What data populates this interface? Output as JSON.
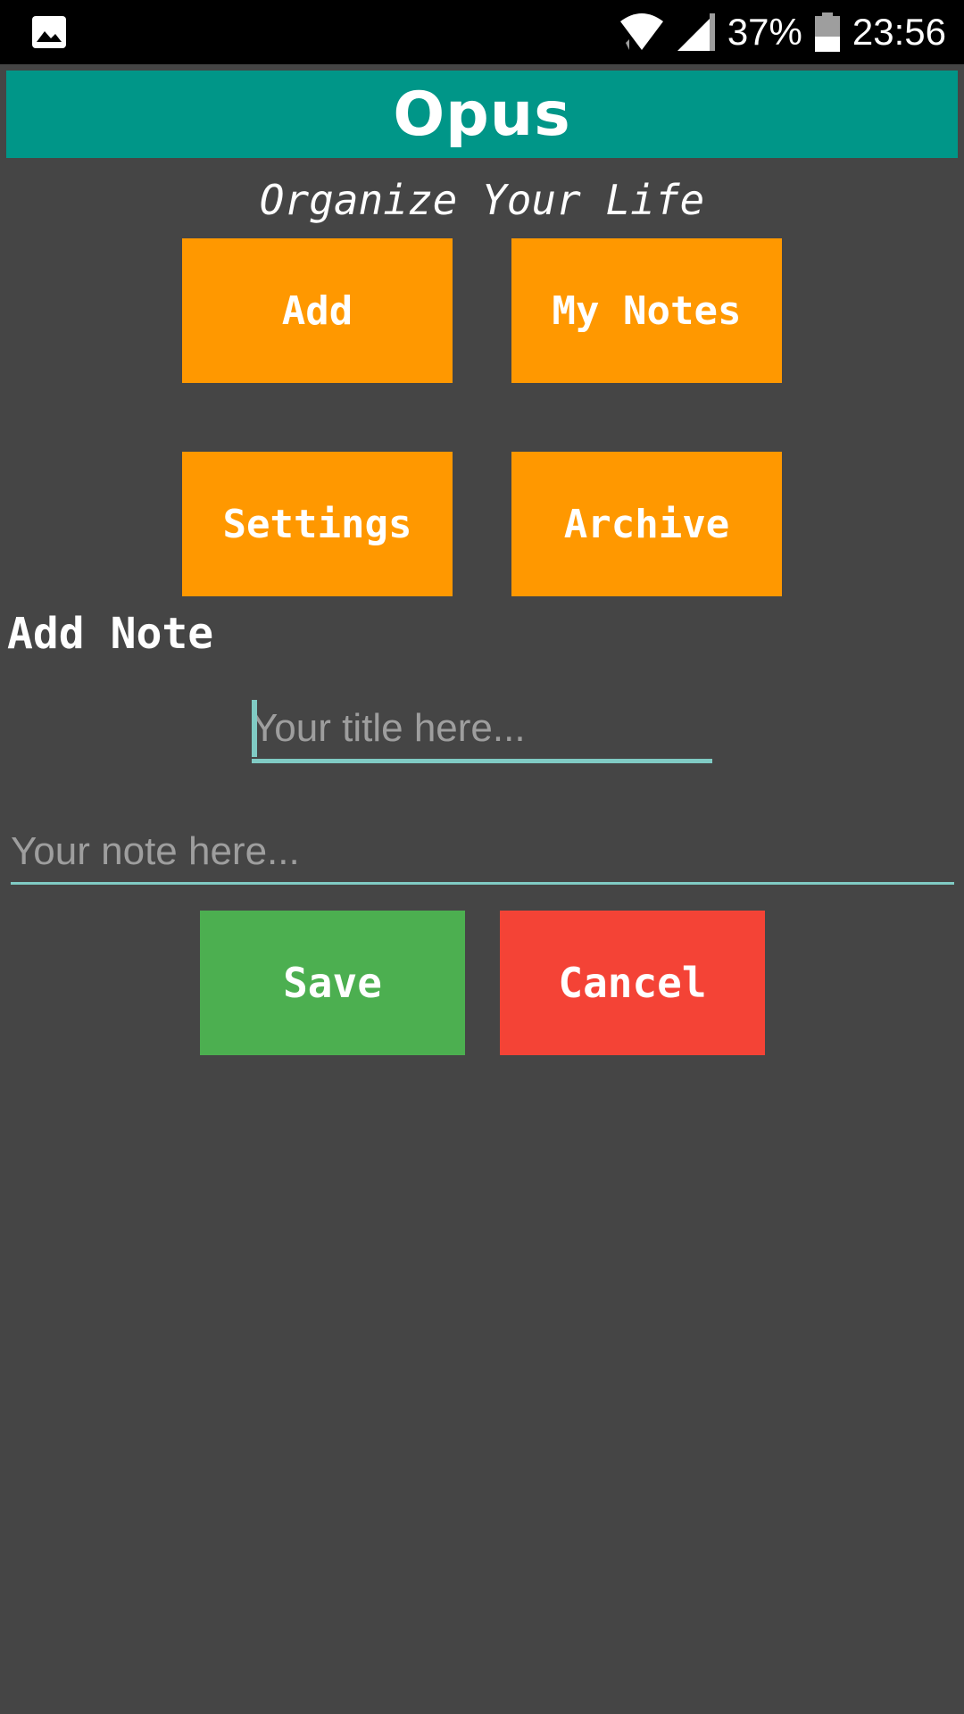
{
  "status_bar": {
    "notification_icon": "image-icon",
    "wifi_icon": "wifi-icon",
    "signal_icon": "cell-signal-icon",
    "battery_icon": "battery-icon",
    "battery_percent": "37%",
    "time": "23:56"
  },
  "app": {
    "title": "Opus",
    "subtitle": "Organize Your Life",
    "colors": {
      "app_bar": "#009688",
      "menu_button": "#ff9800",
      "save_button": "#4caf50",
      "cancel_button": "#f44336",
      "background": "#454545",
      "input_underline": "#80cbc4"
    }
  },
  "menu": {
    "add_label": "Add",
    "my_notes_label": "My Notes",
    "settings_label": "Settings",
    "archive_label": "Archive"
  },
  "add_note": {
    "heading": "Add Note",
    "title_placeholder": "Your title here...",
    "title_value": "",
    "note_placeholder": "Your note here...",
    "note_value": "",
    "save_label": "Save",
    "cancel_label": "Cancel"
  }
}
